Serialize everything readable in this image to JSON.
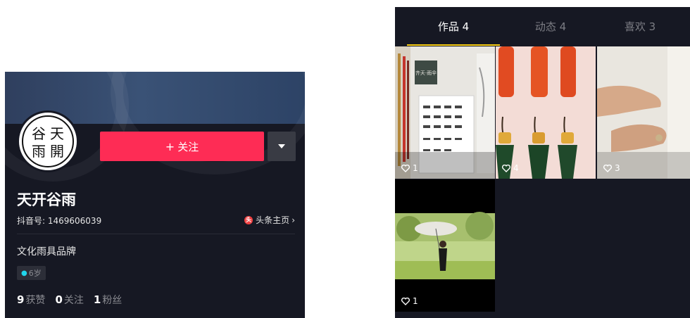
{
  "profile": {
    "avatar_text": [
      "谷",
      "天",
      "雨",
      "開"
    ],
    "follow_button": "关注",
    "follow_plus": "+",
    "name": "天开谷雨",
    "douyin_id": "抖音号: 1469606039",
    "toutiao_link": "头条主页",
    "bio": "文化雨具品牌",
    "age": "6岁",
    "stats": {
      "likes_count": "9",
      "likes_label": "获赞",
      "following_count": "0",
      "following_label": "关注",
      "fans_count": "1",
      "fans_label": "粉丝"
    }
  },
  "works": {
    "tabs": [
      {
        "label": "作品 4",
        "active": true
      },
      {
        "label": "动态 4",
        "active": false
      },
      {
        "label": "喜欢 3",
        "active": false
      }
    ],
    "items": [
      {
        "likes": "1",
        "scene": "umbrella-shop-display"
      },
      {
        "likes": "4",
        "scene": "folded-umbrellas-on-hooks"
      },
      {
        "likes": "3",
        "scene": "hands-close-up"
      },
      {
        "likes": "1",
        "scene": "woman-with-parasol"
      }
    ]
  },
  "colors": {
    "background": "#161823",
    "accent_red": "#fe2c55",
    "tab_indicator": "#face15",
    "muted_text": "#8a8b91"
  }
}
